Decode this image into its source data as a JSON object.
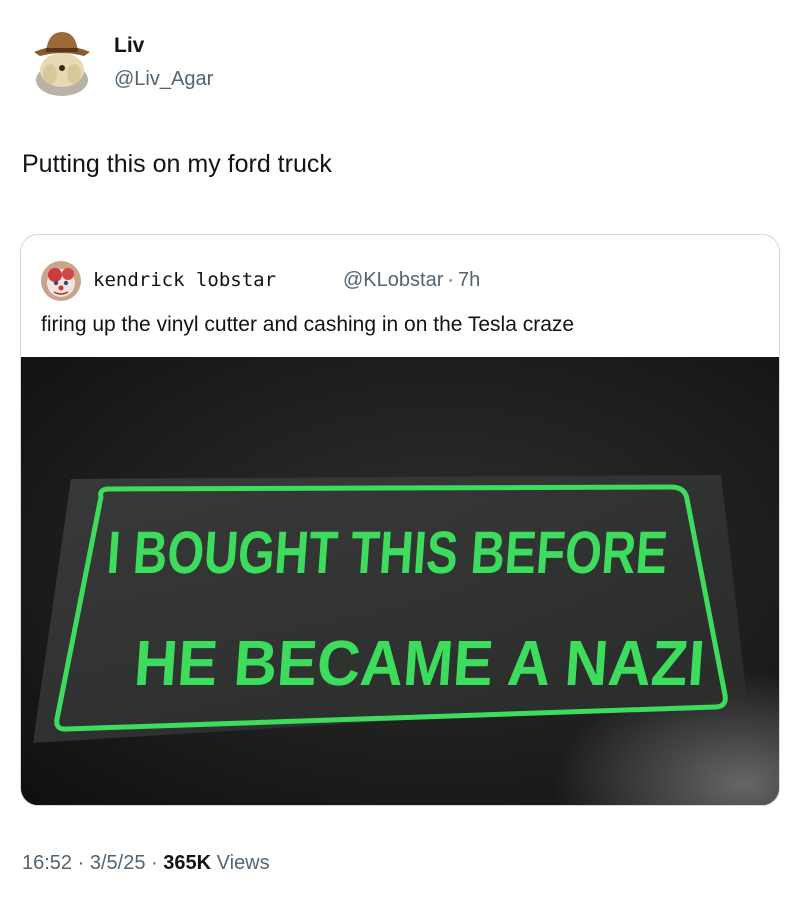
{
  "author": {
    "name": "Liv",
    "handle": "@Liv_Agar"
  },
  "tweet": {
    "text": "Putting this on my ford truck"
  },
  "quoted_tweet": {
    "name": "kendrick lobstar",
    "handle": "@KLobstar",
    "separator": "·",
    "age": "7h",
    "text": "firing up the vinyl cutter and cashing in on the Tesla craze",
    "sticker": {
      "line1": "I BOUGHT THIS BEFORE",
      "line2": "HE BECAME A NAZI",
      "color": "#3ddc5c"
    }
  },
  "meta": {
    "time": "16:52",
    "date": "3/5/25",
    "separator": "·",
    "views_count": "365K",
    "views_label": "Views"
  },
  "colors": {
    "text_primary": "#0f1419",
    "text_secondary": "#536471",
    "border": "#cfd9de"
  }
}
